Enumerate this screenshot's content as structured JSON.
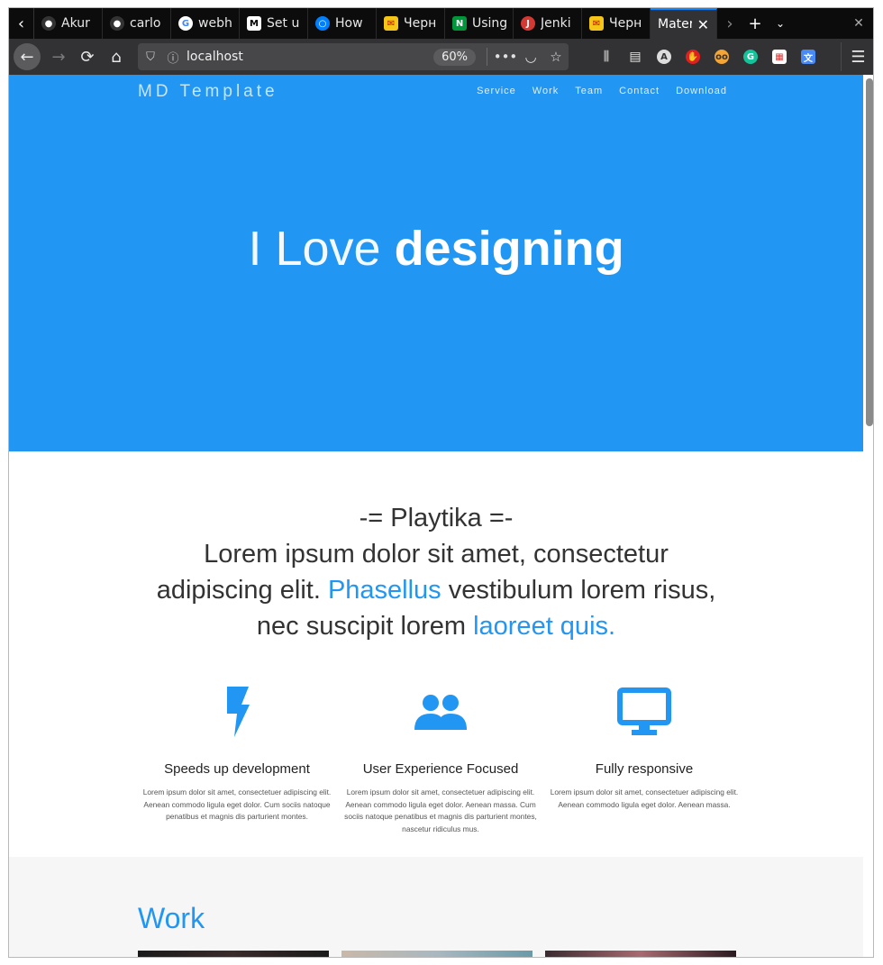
{
  "browser": {
    "tabs": [
      {
        "title": "Akur",
        "icon": "github-icon"
      },
      {
        "title": "carlo",
        "icon": "github-icon"
      },
      {
        "title": "webh",
        "icon": "google-icon"
      },
      {
        "title": "Set u",
        "icon": "medium-icon"
      },
      {
        "title": "How",
        "icon": "digitalocean-icon"
      },
      {
        "title": "Черн",
        "icon": "mail-icon"
      },
      {
        "title": "Using",
        "icon": "nginx-icon"
      },
      {
        "title": "Jenki",
        "icon": "jenkins-icon"
      },
      {
        "title": "Черн",
        "icon": "mail-icon"
      },
      {
        "title": "Mater",
        "icon": "page-icon",
        "active": true
      }
    ],
    "url": "localhost",
    "zoom": "60%"
  },
  "site": {
    "brand": "MD Template",
    "nav": [
      "Service",
      "Work",
      "Team",
      "Contact",
      "Download"
    ],
    "hero": {
      "light": "I Love",
      "bold": "designing"
    },
    "intro": {
      "line1": "-= Playtika =-",
      "line2": "Lorem ipsum dolor sit amet, consectetur",
      "line3a": "adipiscing elit. ",
      "line3hl": "Phasellus",
      "line3b": " vestibulum lorem risus,",
      "line4a": "nec suscipit lorem ",
      "line4hl": "laoreet quis."
    },
    "features": [
      {
        "icon": "lightning-icon",
        "title": "Speeds up development",
        "text": "Lorem ipsum dolor sit amet, consectetuer adipiscing elit. Aenean commodo ligula eget dolor. Cum sociis natoque penatibus et magnis dis parturient montes."
      },
      {
        "icon": "people-icon",
        "title": "User Experience Focused",
        "text": "Lorem ipsum dolor sit amet, consectetuer adipiscing elit. Aenean commodo ligula eget dolor. Aenean massa. Cum sociis natoque penatibus et magnis dis parturient montes, nascetur ridiculus mus."
      },
      {
        "icon": "monitor-icon",
        "title": "Fully responsive",
        "text": "Lorem ipsum dolor sit amet, consectetuer adipiscing elit. Aenean commodo ligula eget dolor. Aenean massa."
      }
    ],
    "work_title": "Work"
  },
  "colors": {
    "primary": "#2196f3",
    "toolbar": "#323234",
    "tabbar": "#0c0c0d"
  }
}
